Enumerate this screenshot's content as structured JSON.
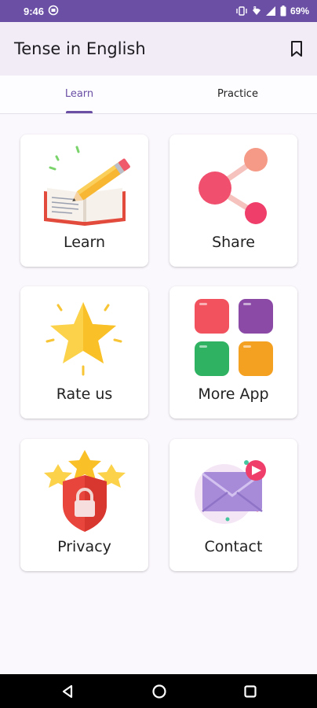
{
  "status_bar": {
    "time": "9:46",
    "battery": "69%",
    "icons": [
      "notification-icon",
      "vibrate-icon",
      "wifi-icon",
      "signal-icon",
      "battery-icon"
    ]
  },
  "app_bar": {
    "title": "Tense in English",
    "action_icon": "bookmark-icon"
  },
  "tabs": [
    {
      "label": "Learn",
      "selected": true
    },
    {
      "label": "Practice",
      "selected": false
    }
  ],
  "cards": [
    {
      "label": "Learn",
      "icon": "book-pencil-icon"
    },
    {
      "label": "Share",
      "icon": "share-icon"
    },
    {
      "label": "Rate us",
      "icon": "star-icon"
    },
    {
      "label": "More App",
      "icon": "apps-grid-icon"
    },
    {
      "label": "Privacy",
      "icon": "shield-lock-icon"
    },
    {
      "label": "Contact",
      "icon": "mail-icon"
    }
  ],
  "nav_bar": {
    "buttons": [
      "back-icon",
      "home-icon",
      "recents-icon"
    ]
  },
  "colors": {
    "primary": "#6a4fa5",
    "app_bar": "#f1ecf6",
    "background": "#fbf8fd"
  }
}
